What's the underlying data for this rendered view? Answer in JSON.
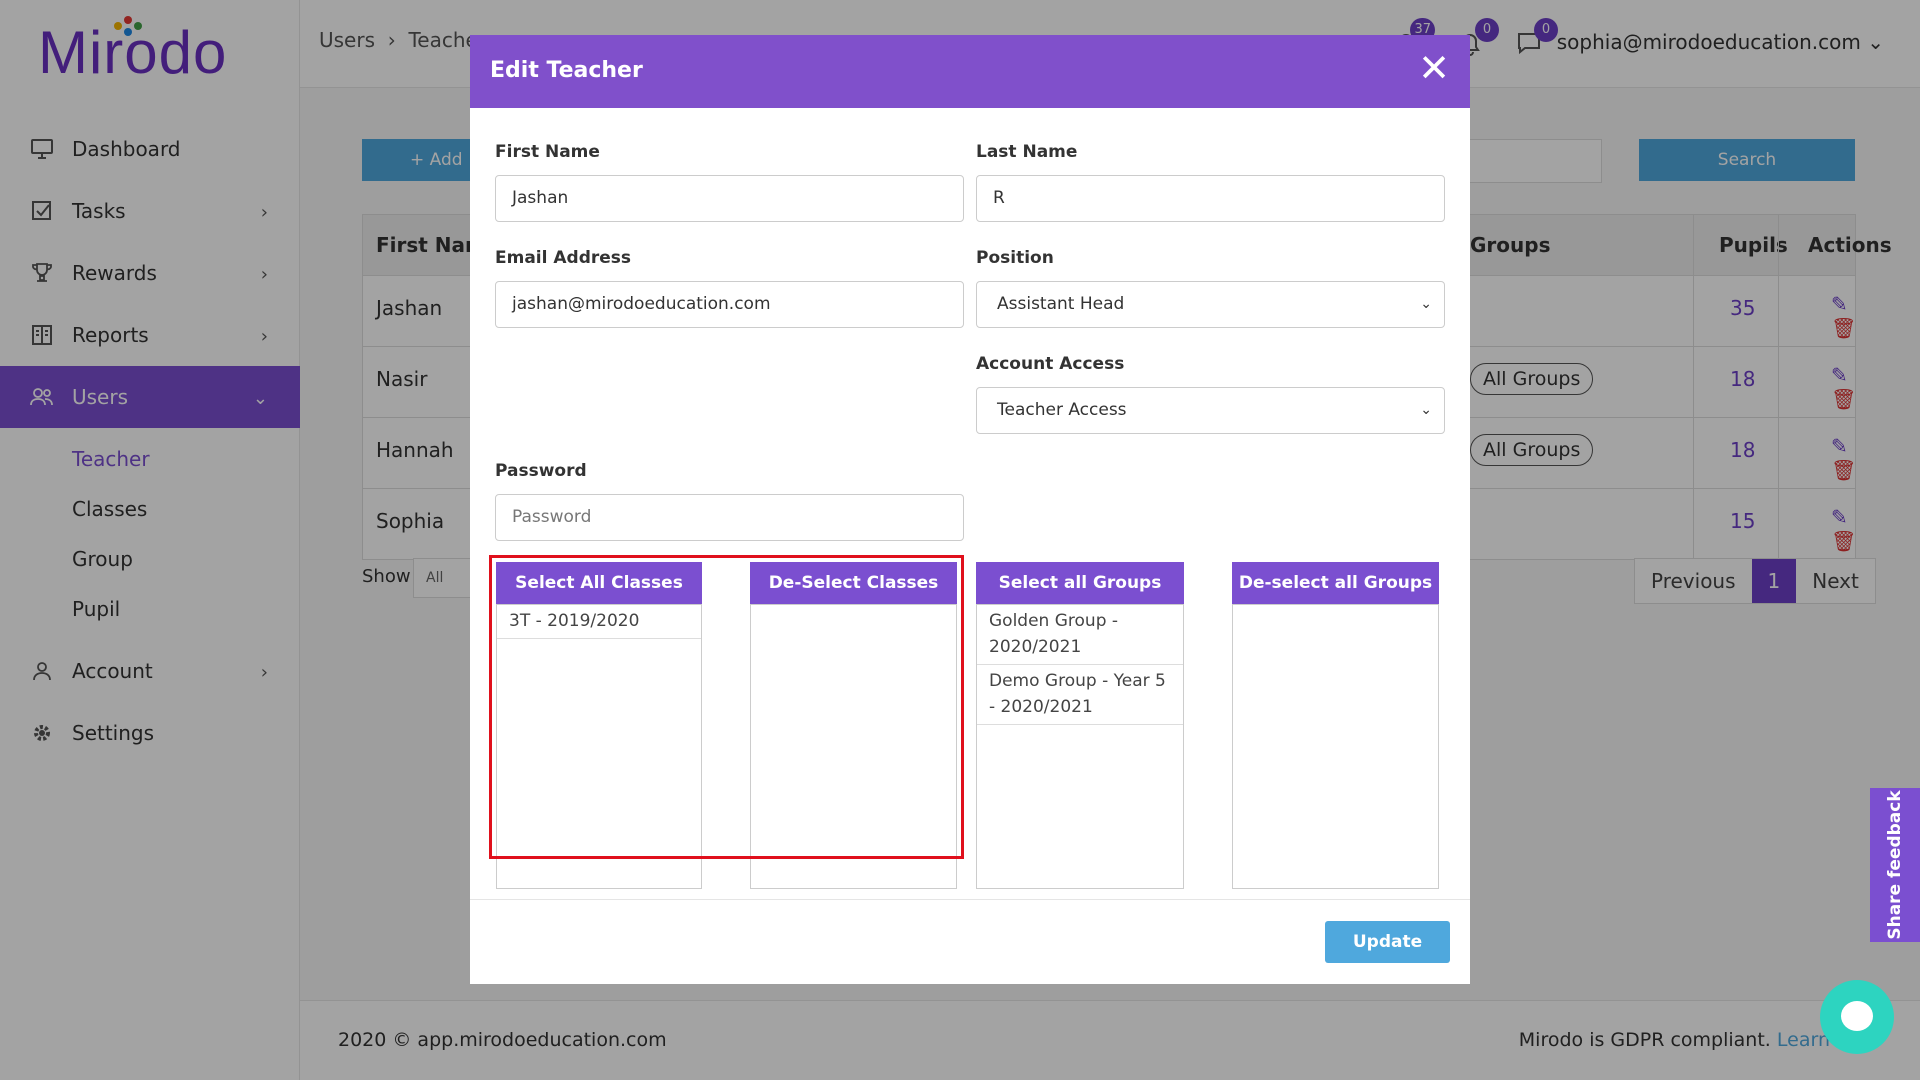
{
  "app": {
    "logo_text": "Mirodo"
  },
  "sidebar": {
    "items": [
      {
        "label": "Dashboard",
        "icon": "monitor-icon"
      },
      {
        "label": "Tasks",
        "icon": "tasks-icon"
      },
      {
        "label": "Rewards",
        "icon": "trophy-icon"
      },
      {
        "label": "Reports",
        "icon": "reports-icon"
      },
      {
        "label": "Users",
        "icon": "users-icon"
      },
      {
        "label": "Account",
        "icon": "account-icon"
      },
      {
        "label": "Settings",
        "icon": "gear-icon"
      }
    ],
    "subitems": [
      "Teacher",
      "Classes",
      "Group",
      "Pupil"
    ]
  },
  "header": {
    "breadcrumb_root": "Users",
    "breadcrumb_current": "Teache",
    "notifications_count": "37",
    "alerts_count": "0",
    "messages_count": "0",
    "user_email": "sophia@mirodoeducation.com"
  },
  "page": {
    "add_label": "Add",
    "search_label": "Search",
    "columns": {
      "first_name": "First Nam",
      "groups": "Groups",
      "pupils": "Pupils",
      "actions": "Actions"
    },
    "rows": [
      {
        "first_name": "Jashan",
        "groups": "",
        "pupils": "35"
      },
      {
        "first_name": "Nasir",
        "groups": "All Groups",
        "pupils": "18"
      },
      {
        "first_name": "Hannah",
        "groups": "All Groups",
        "pupils": "18"
      },
      {
        "first_name": "Sophia",
        "groups": "",
        "pupils": "15"
      }
    ],
    "show_label": "Show",
    "show_value": "All",
    "pager": {
      "previous": "Previous",
      "current": "1",
      "next": "Next"
    }
  },
  "footer": {
    "copyright": "2020 © app.mirodoeducation.com",
    "gdpr": "Mirodo is GDPR compliant.",
    "learn": "Learn"
  },
  "modal": {
    "title": "Edit Teacher",
    "first_name_label": "First Name",
    "first_name_value": "Jashan",
    "last_name_label": "Last Name",
    "last_name_value": "R",
    "email_label": "Email Address",
    "email_value": "jashan@mirodoeducation.com",
    "position_label": "Position",
    "position_value": "Assistant Head",
    "account_access_label": "Account Access",
    "account_access_value": "Teacher Access",
    "password_label": "Password",
    "password_placeholder": "Password",
    "select_all_classes": "Select All Classes",
    "deselect_classes": "De-Select Classes",
    "select_all_groups": "Select all Groups",
    "deselect_all_groups": "De-select all Groups",
    "available_classes": [
      "3T - 2019/2020"
    ],
    "selected_classes": [],
    "available_groups": [
      "Golden Group - 2020/2021",
      "Demo Group - Year 5 - 2020/2021"
    ],
    "selected_groups": [],
    "update_label": "Update"
  },
  "widgets": {
    "feedback_label": "Share feedback"
  },
  "colors": {
    "brand": "#7b4fd0",
    "header": "#8050cb",
    "accent": "#4fa8dd",
    "highlight": "#e0101c",
    "chat": "#2dd4c0"
  }
}
